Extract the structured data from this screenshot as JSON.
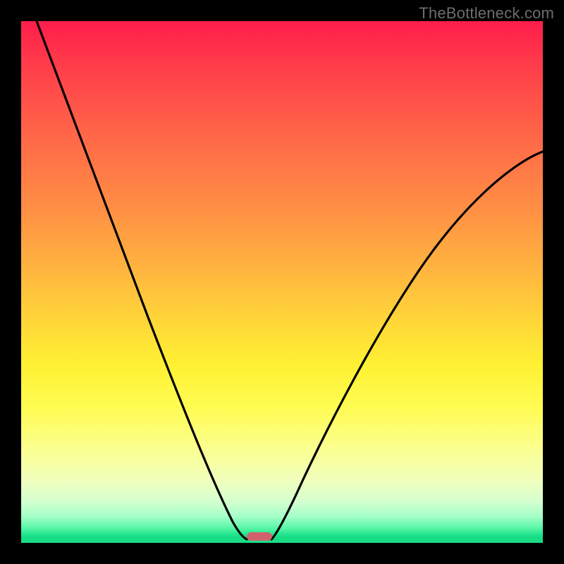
{
  "watermark": {
    "text": "TheBottleneck.com"
  },
  "chart_data": {
    "type": "line",
    "title": "",
    "xlabel": "",
    "ylabel": "",
    "xlim": [
      0,
      100
    ],
    "ylim": [
      0,
      100
    ],
    "grid": false,
    "legend": false,
    "series": [
      {
        "name": "left-curve",
        "x": [
          3,
          6,
          10,
          14,
          18,
          22,
          26,
          30,
          33,
          36,
          38,
          40,
          41.5,
          43
        ],
        "y": [
          100,
          90,
          78,
          66,
          55,
          44,
          34,
          25,
          18,
          12,
          7.5,
          4,
          2,
          0.7
        ]
      },
      {
        "name": "right-curve",
        "x": [
          48,
          50,
          53,
          57,
          62,
          68,
          75,
          83,
          91,
          100
        ],
        "y": [
          0.7,
          3,
          8,
          15,
          24,
          34,
          45,
          56,
          66,
          75
        ]
      }
    ],
    "marker": {
      "x_center": 45.5,
      "y": 0.7,
      "color": "#d1626d"
    },
    "background_gradient": {
      "top": "#ff1d4b",
      "mid": "#ffd838",
      "bottom": "#1cde86"
    }
  }
}
